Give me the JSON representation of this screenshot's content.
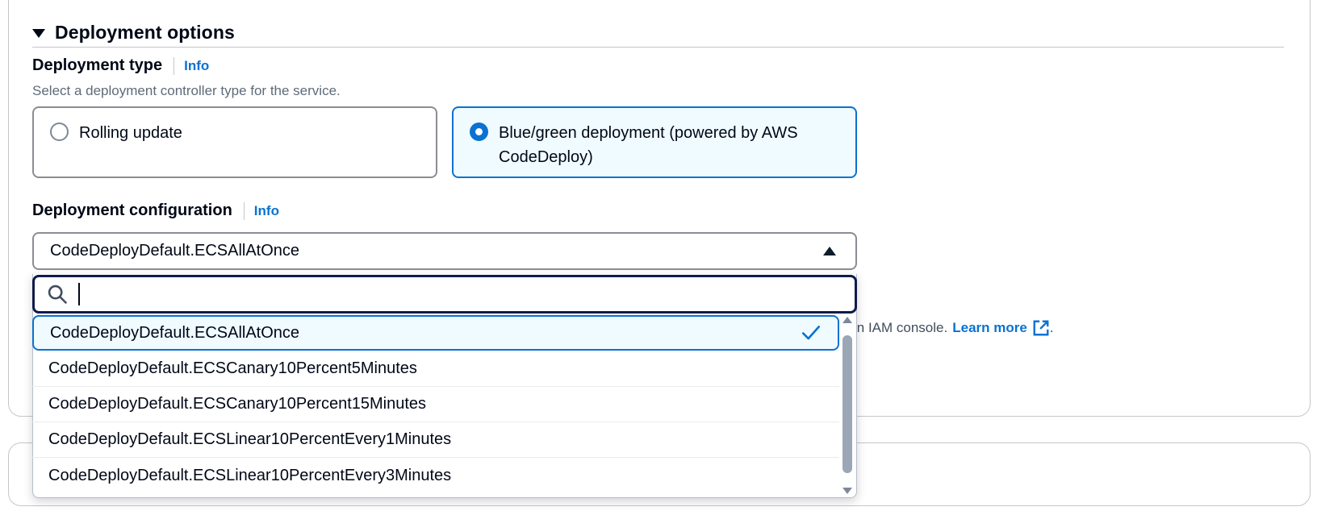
{
  "section": {
    "title": "Deployment options"
  },
  "deployment_type": {
    "label": "Deployment type",
    "info": "Info",
    "description": "Select a deployment controller type for the service.",
    "options": [
      {
        "label": "Rolling update",
        "selected": false
      },
      {
        "label": "Blue/green deployment (powered by AWS CodeDeploy)",
        "selected": true
      }
    ]
  },
  "deployment_configuration": {
    "label": "Deployment configuration",
    "info": "Info",
    "selected_value": "CodeDeployDefault.ECSAllAtOnce",
    "search": {
      "value": "",
      "placeholder": ""
    },
    "options": [
      "CodeDeployDefault.ECSAllAtOnce",
      "CodeDeployDefault.ECSCanary10Percent5Minutes",
      "CodeDeployDefault.ECSCanary10Percent15Minutes",
      "CodeDeployDefault.ECSLinear10PercentEvery1Minutes",
      "CodeDeployDefault.ECSLinear10PercentEvery3Minutes"
    ]
  },
  "background_helper": {
    "text": "in IAM console.",
    "learn_more": "Learn more",
    "trailing": "."
  },
  "colors": {
    "accent": "#0972d3",
    "selected_bg": "#f0fbff",
    "border": "#8c8c94",
    "text": "#000716"
  },
  "icons": {
    "expand": "caret-down-icon",
    "dropdown": "caret-up-icon",
    "search": "search-icon",
    "selected": "check-icon",
    "external": "external-link-icon"
  }
}
